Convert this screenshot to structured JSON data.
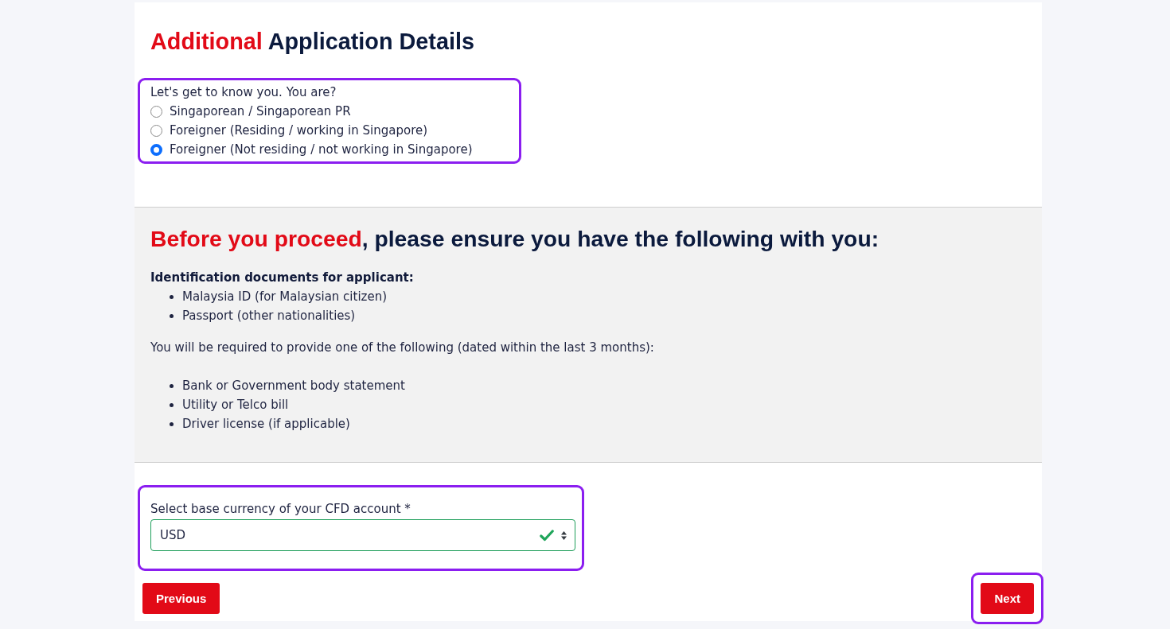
{
  "application_details": {
    "heading": [
      {
        "text": "Additional",
        "accent": true
      },
      {
        "text": " Application Details",
        "accent": false
      }
    ],
    "question": {
      "label": "Let's get to know you. You are?",
      "highlighted": true,
      "options": [
        {
          "label": "Singaporean / Singaporean PR",
          "selected": false
        },
        {
          "label": "Foreigner (Residing / working in Singapore)",
          "selected": false
        },
        {
          "label": "Foreigner (Not residing / not working in Singapore)",
          "selected": true
        }
      ]
    }
  },
  "requirements": {
    "heading": [
      {
        "text": "Before you proceed",
        "accent": true
      },
      {
        "text": ", please ensure you have the following with you:",
        "accent": false
      }
    ],
    "blocks": [
      {
        "kind": "list",
        "title": "Identification documents for applicant:",
        "items": [
          "Malaysia ID (for Malaysian citizen)",
          "Passport (other nationalities)"
        ]
      },
      {
        "kind": "paragraph",
        "text": "You will be required to provide one of the following (dated within the last 3 months):"
      },
      {
        "kind": "list",
        "items": [
          "Bank or Government body statement",
          "Utility or Telco bill",
          "Driver license (if applicable)"
        ]
      }
    ]
  },
  "currency": {
    "label": "Select base currency of your CFD account *",
    "value": "USD",
    "valid": true,
    "highlighted": true
  },
  "buttons": [
    {
      "label": "Previous",
      "highlighted": false
    },
    {
      "label": "Next",
      "highlighted": true
    }
  ]
}
